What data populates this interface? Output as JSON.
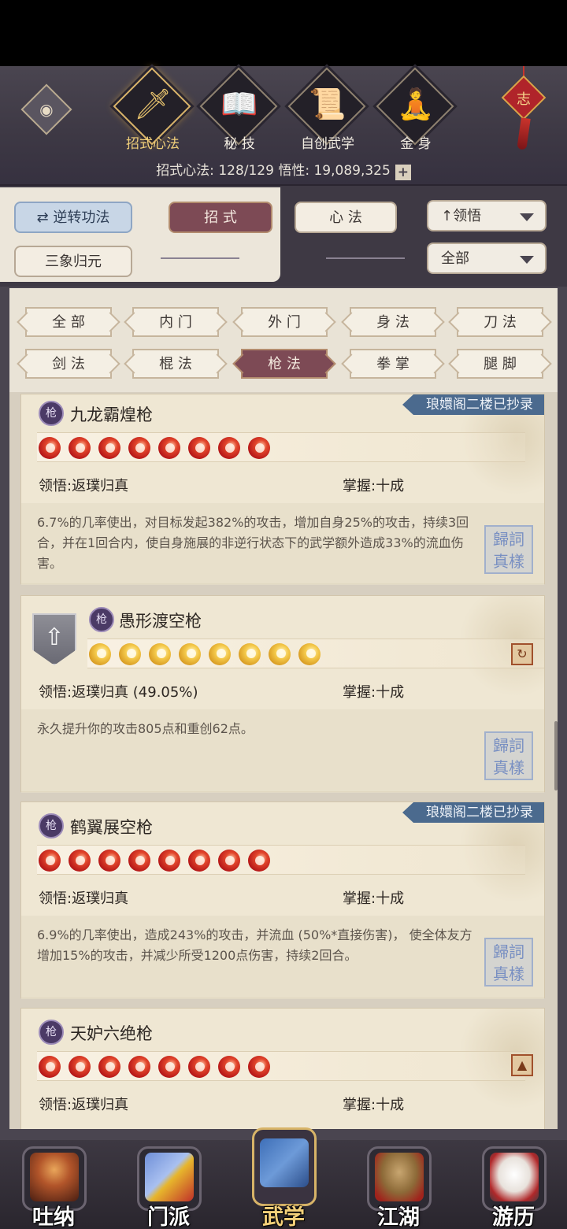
{
  "header": {
    "tabs": [
      {
        "label": "招式心法",
        "icon": "sword-icon"
      },
      {
        "label": "秘 技",
        "icon": "book-icon"
      },
      {
        "label": "自创武学",
        "icon": "scroll-icon"
      },
      {
        "label": "金 身",
        "icon": "meditation-icon"
      }
    ],
    "knot_char": "志",
    "stats_text": "招式心法: 128/129   悟性: 19,089,325"
  },
  "filters": {
    "reverse_label": "逆转功法",
    "sanxiang_label": "三象归元",
    "zhaoshi_label": "招 式",
    "xinfa_label": "心 法",
    "sort_label": "领悟",
    "scope_label": "全部"
  },
  "categories": [
    "全 部",
    "内 门",
    "外 门",
    "身 法",
    "刀 法",
    "剑 法",
    "棍 法",
    "枪 法",
    "拳 掌",
    "腿 脚"
  ],
  "active_category": "枪 法",
  "skills": [
    {
      "name": "九龙霸煌枪",
      "ribbon": "琅嬛阁二楼已抄录",
      "orb_color": "red",
      "orbs": 8,
      "comprehension": "领悟:返璞归真",
      "mastery": "掌握:十成",
      "desc": "6.7%的几率使出，对目标发起382%的攻击，增加自身25%的攻击，持续3回合，并在1回合内，使自身施展的非逆行状态下的武学额外造成33%的流血伤害。",
      "seal": "歸詞 真樣"
    },
    {
      "name": "愚形渡空枪",
      "ribbon": "",
      "orb_color": "gold",
      "orbs": 8,
      "comprehension": "领悟:返璞归真 (49.05%)",
      "mastery": "掌握:十成",
      "desc": "永久提升你的攻击805点和重创62点。",
      "seal": "歸詞 真樣"
    },
    {
      "name": "鹤翼展空枪",
      "ribbon": "琅嬛阁二楼已抄录",
      "orb_color": "red",
      "orbs": 8,
      "comprehension": "领悟:返璞归真",
      "mastery": "掌握:十成",
      "desc": "6.9%的几率使出，造成243%的攻击，并流血 (50%*直接伤害)， 使全体友方增加15%的攻击，并减少所受1200点伤害，持续2回合。",
      "seal": "歸詞 真樣"
    },
    {
      "name": "天妒六绝枪",
      "ribbon": "",
      "orb_color": "red",
      "orbs": 8,
      "comprehension": "领悟:返璞归真",
      "mastery": "掌握:十成",
      "desc": "",
      "seal": ""
    }
  ],
  "bottom_nav": [
    {
      "label": "吐纳",
      "icon": "monk-icon"
    },
    {
      "label": "门派",
      "icon": "banner-icon"
    },
    {
      "label": "武学",
      "icon": "manual-book-icon"
    },
    {
      "label": "江湖",
      "icon": "straw-hat-icon"
    },
    {
      "label": "游历",
      "icon": "horse-icon"
    }
  ],
  "active_nav": "武学",
  "colors": {
    "accent_red": "#7d4a55",
    "accent_blue": "#4b6a8e",
    "gold": "#d9b46a"
  }
}
